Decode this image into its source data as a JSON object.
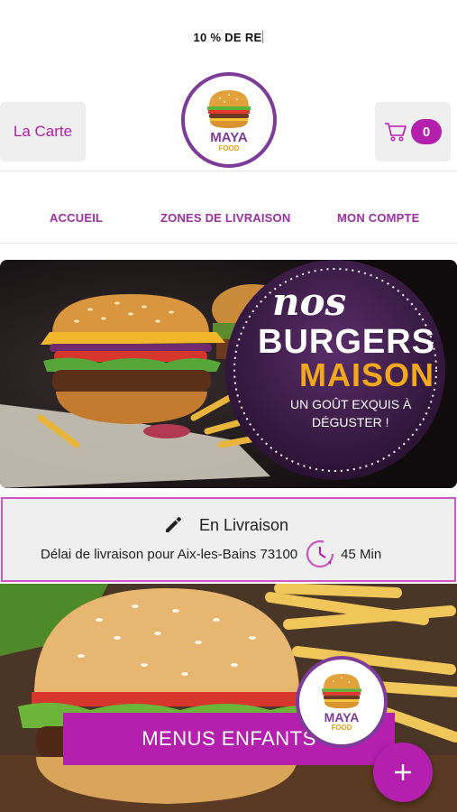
{
  "promo": {
    "text": "10 % DE RE"
  },
  "header": {
    "menu_label": "La Carte",
    "logo": {
      "brand": "MAYA",
      "sub": "FOOD"
    },
    "cart": {
      "count": "0"
    }
  },
  "nav": {
    "items": [
      {
        "label": "ACCUEIL"
      },
      {
        "label": "ZONES DE LIVRAISON"
      },
      {
        "label": "MON COMPTE"
      }
    ]
  },
  "banner": {
    "line1": "nos",
    "line2": "BURGERS",
    "line3": "MAISON",
    "line4": "UN GOÛT EXQUIS À",
    "line5": "DÉGUSTER !"
  },
  "delivery": {
    "mode": "En Livraison",
    "text": "Délai de livraison pour Aix-les-Bains 73100",
    "time": "45 Min"
  },
  "category_card": {
    "label": "MENUS ENFANTS",
    "logo": {
      "brand": "MAYA",
      "sub": "FOOD"
    }
  },
  "colors": {
    "accent": "#b51fae",
    "brand_purple": "#7d3b9a",
    "brand_orange": "#e4a11d"
  },
  "icons": [
    "cart-icon",
    "pencil-icon",
    "clock-icon",
    "plus-icon",
    "burger-icon"
  ]
}
